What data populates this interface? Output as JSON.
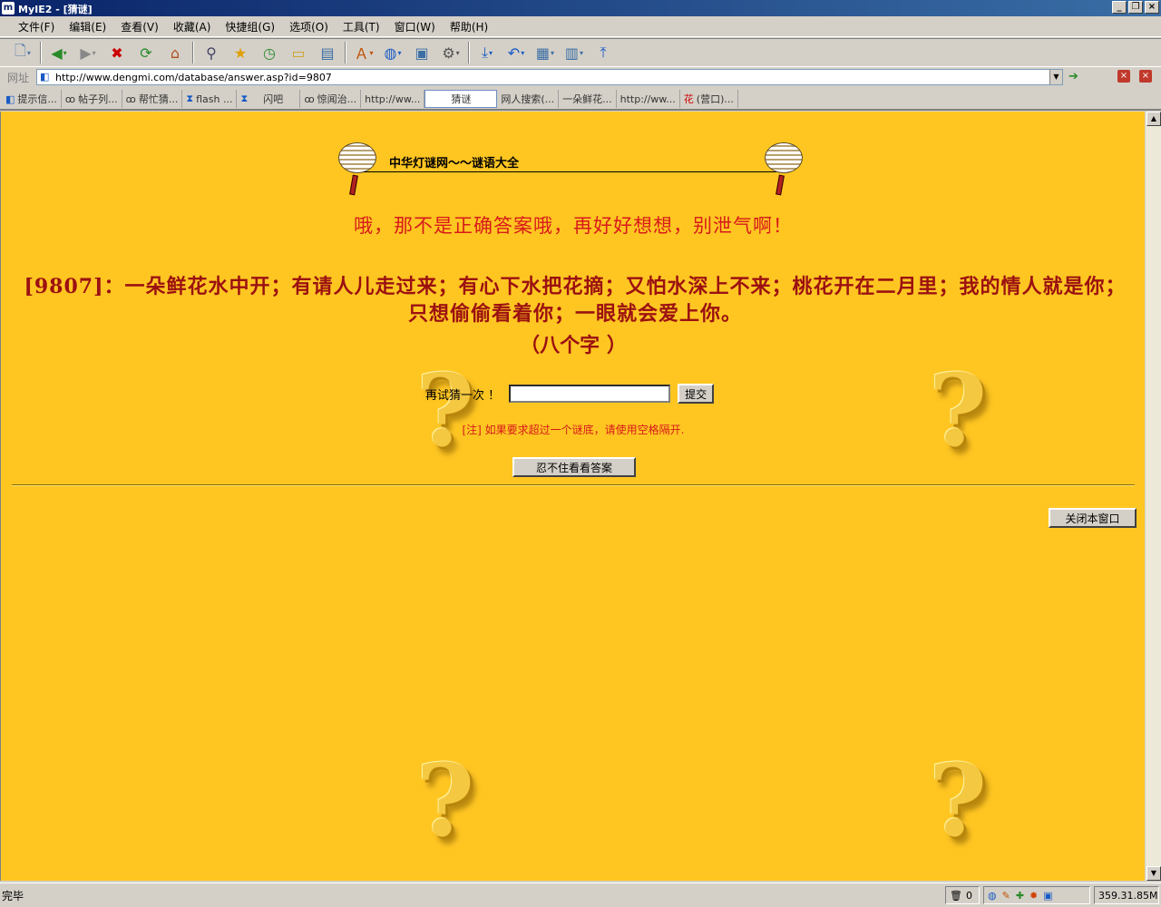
{
  "window": {
    "title": "MyIE2 - [猜谜]",
    "app_icon": "m",
    "controls": [
      "_",
      "❐",
      "×"
    ]
  },
  "menu": [
    "文件(F)",
    "编辑(E)",
    "查看(V)",
    "收藏(A)",
    "快捷组(G)",
    "选项(O)",
    "工具(T)",
    "窗口(W)",
    "帮助(H)"
  ],
  "toolbar_icons": [
    "new-page-icon",
    "back-icon",
    "forward-icon",
    "stop-icon",
    "refresh-icon",
    "home-icon",
    "search-icon",
    "favorites-icon",
    "history-icon",
    "folder-icon",
    "document-icon",
    "translate-icon",
    "globe-icon",
    "window-icon",
    "tools-icon",
    "download-icon",
    "undo-icon",
    "grid-icon",
    "columns-icon",
    "upload-icon"
  ],
  "address": {
    "label": "网址",
    "url": "http://www.dengmi.com/database/answer.asp?id=9807"
  },
  "tabs": [
    {
      "label": "提示信...",
      "icon": "info-icon"
    },
    {
      "label": "帖子列...",
      "icon": "bike-icon"
    },
    {
      "label": "帮忙猜...",
      "icon": "bike-icon"
    },
    {
      "label": "flash ...",
      "icon": "hourglass-icon"
    },
    {
      "label": "闪吧",
      "icon": "hourglass-icon"
    },
    {
      "label": "惊闻治...",
      "icon": "bike-icon"
    },
    {
      "label": "http://ww...",
      "icon": ""
    },
    {
      "label": "猜谜",
      "icon": "",
      "active": true
    },
    {
      "label": "网人搜索(...",
      "icon": ""
    },
    {
      "label": "一朵鲜花...",
      "icon": ""
    },
    {
      "label": "http://ww...",
      "icon": ""
    },
    {
      "label": "(营口)...",
      "icon": "flower-icon",
      "prefix": "花"
    }
  ],
  "page": {
    "site_title": "中华灯谜网～～谜语大全",
    "error_message": "哦，那不是正确答案哦，再好好想想，别泄气啊！",
    "riddle": "[9807]：一朵鲜花水中开；有请人儿走过来；有心下水把花摘；又怕水深上不来；桃花开在二月里；我的情人就是你；只想偷偷看着你；一眼就会爱上你。",
    "hint": "（八个字 ）",
    "guess_label": "再试猜一次 ！",
    "guess_value": "",
    "submit_label": "提交",
    "note": "[注] 如果要求超过一个谜底，请使用空格隔开.",
    "show_answer_label": "忍不住看看答案",
    "close_label": "关闭本窗口",
    "background_color": "#ffc622",
    "accent_color": "#d71a1a"
  },
  "status": {
    "text": "完毕",
    "trash_count": "0",
    "memory": "359.31.85M"
  }
}
